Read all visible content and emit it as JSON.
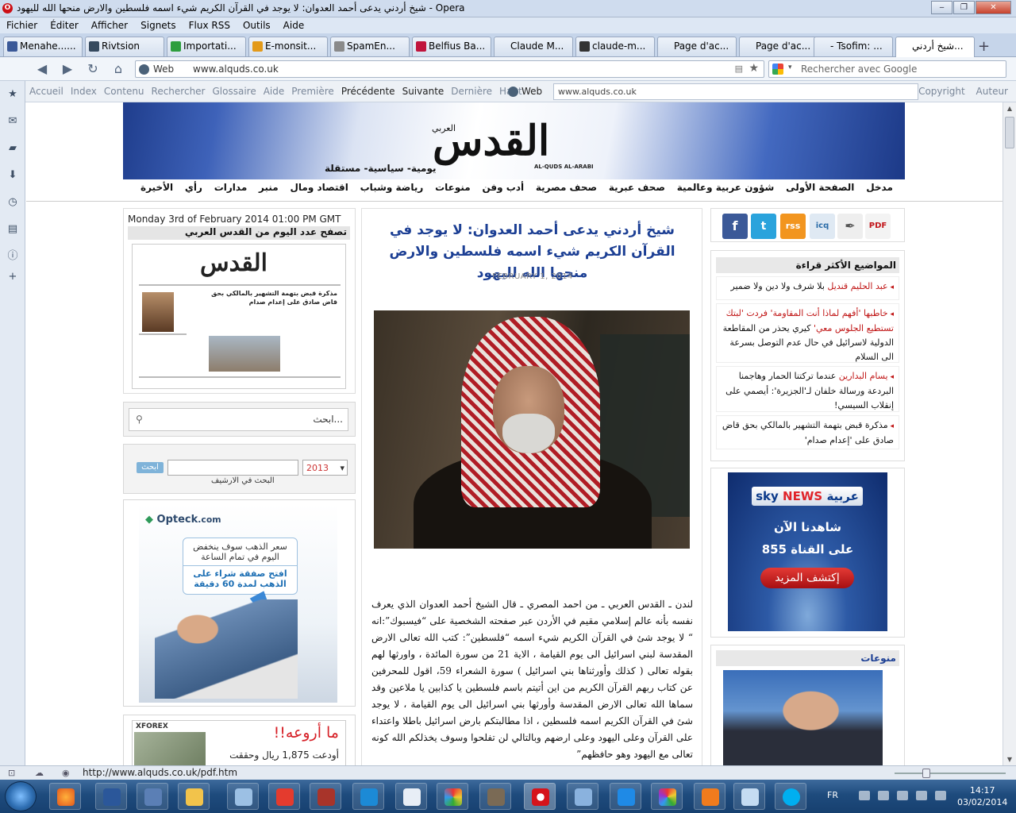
{
  "window": {
    "title": "شيخ أردني يدعى أحمد العدوان: لا يوجد في القرآن الكريم شيء اسمه فلسطين والارض منحها الله لليهود - Opera",
    "min": "‒",
    "max": "❐",
    "close": "✕"
  },
  "menu": [
    "Fichier",
    "Éditer",
    "Afficher",
    "Signets",
    "Flux RSS",
    "Outils",
    "Aide"
  ],
  "tabs": [
    {
      "label": "Menahe......",
      "color": "#3b5998"
    },
    {
      "label": "Rivtsion",
      "color": "#35495e"
    },
    {
      "label": "Importati...",
      "color": "#2e9e3e"
    },
    {
      "label": "E-monsit...",
      "color": "#e39a1a"
    },
    {
      "label": "SpamEn...",
      "color": "#8a8a8a"
    },
    {
      "label": "Belfius Ba...",
      "color": "#c0143c"
    },
    {
      "label": "Claude M...",
      "color": "#dddddd"
    },
    {
      "label": "claude-m...",
      "color": "#333333"
    },
    {
      "label": "Page d'ac...",
      "color": "#dddddd"
    },
    {
      "label": "Page d'ac...",
      "color": "#dddddd"
    },
    {
      "label": "- Tsofim: ...",
      "color": "#dddddd"
    },
    {
      "label": "شيخ أردني...",
      "color": "#ffffff"
    }
  ],
  "address": {
    "web": "Web",
    "url": "www.alquds.co.uk",
    "search_placeholder": "Rechercher avec Google"
  },
  "navbar": {
    "items": [
      "Accueil",
      "Index",
      "Contenu",
      "Rechercher",
      "Glossaire",
      "Aide",
      "Première",
      "Précédente",
      "Suivante",
      "Dernière",
      "Haut"
    ],
    "web": "Web",
    "url": "www.alquds.co.uk",
    "right": [
      "Copyright",
      "Auteur"
    ]
  },
  "site": {
    "logo": "القدس",
    "logo_sub": "العربي",
    "logo_en": "AL-QUDS AL-ARABI",
    "tagline": "يومية- سياسية- مستقلة",
    "nav": [
      "مدخل",
      "الصفحة الأولى",
      "شؤون عربية وعالمية",
      "صحف عبرية",
      "صحف مصرية",
      "أدب وفن",
      "منوعات",
      "رياضة وشباب",
      "اقتصاد ومال",
      "منبر",
      "مدارات",
      "رأي",
      "الأخيرة"
    ],
    "date": "Monday 3rd of February 2014 01:00 PM GMT",
    "paper_header": "تصفح عدد اليوم من القدس العربي",
    "paper_logo": "القدس",
    "paper_headline": "مذكرة قبض بتهمة التشهير بالمالكي بحق قاض صادق على إعدام صدام",
    "search_placeholder": "ابحث...",
    "archive": {
      "button": "ابحث",
      "year": "2013",
      "label": "البحث في الارشيف"
    },
    "ad1": {
      "brand": "Opteck",
      "brand_suffix": ".com",
      "line1": "سعر الذهب سوف ينخفض اليوم في تمام الساعة",
      "line2": "افتح صفقة شراء على الذهب لمدة 60 دقيقة"
    },
    "ad2": {
      "brand": "XFOREX",
      "headline": "ما أروعه!!",
      "sub": "أودعت 1,875 ريال وحققت"
    },
    "article": {
      "headline": "شيخ أردني يدعى أحمد العدوان: لا يوجد في القرآن الكريم شيء اسمه فلسطين والارض منحها الله لليهود",
      "date": "FEBRUARY 1, 2014",
      "body": "لندن ـ القدس العربي ـ من احمد المصري ـ قال الشيخ أحمد العدوان الذي يعرف نفسه بأنه عالم إسلامي مقيم في الأردن عبر صفحته الشخصية على “فيسبوك”:انه “ لا يوجد شئ في القرآن الكريم شيء اسمه “فلسطين”: كتب الله تعالى الارض المقدسة لبني اسرائيل الى يوم القيامة ، الاية 21 من سورة المائدة ، واورثها لهم بقوله تعالى ( كذلك وأورثناها بني اسرائيل ) سورة الشعراء 59، اقول للمحرفين عن كتاب ربهم القرآن الكريم من اين أتيتم باسم فلسطين يا كذابين يا ملاعين وقد سماها الله تعالى الارض المقدسة وأورثها بني اسرائيل الى يوم القيامة ، لا يوجد شئ في القرآن الكريم اسمه فلسطين ، اذا مطالبتكم بارض اسرائيل باطلا واعتداء على القرآن وعلى اليهود وعلى ارضهم وبالتالي لن تفلحوا وسوف يخذلكم الله كونه تعالى مع اليهود وهو حافظهم”"
    },
    "social": [
      "f",
      "t",
      "rss",
      "icq",
      "✒",
      "PDF"
    ],
    "popular_title": "المواضيع الأكثر قراءة",
    "popular": [
      {
        "bold": "عبد الحليم قنديل",
        "text": "بلا شرف ولا دين ولا ضمير"
      },
      {
        "bold": "خاطبها 'أفهم لماذا أنت المقاومة' فردت 'لبتك تستطيع الجلوس معي'",
        "text": "كيري يحذر من المقاطعة الدولية لاسرائيل في حال عدم التوصل بسرعة الى السلام"
      },
      {
        "bold": "يسام البدارين",
        "text": "عندما تركتنا الحمار وهاجمنا البردعة ورسالة خلفان لـ'الجزيرة': أيصمي على إنقلاب السيسي!"
      },
      {
        "bold": "",
        "text": "مذكرة قبض بتهمة التشهير بالمالكي بحق قاض صادق على 'إعدام صدام'"
      }
    ],
    "sky": {
      "brand1": "sky",
      "brand2": "NEWS",
      "brand3": "عربية",
      "line1": "شاهدنا الآن",
      "line2": "على القناة 855",
      "cta": "إكتشف المزيد"
    },
    "misc_title": "منوعات"
  },
  "status": {
    "url": "http://www.alquds.co.uk/pdf.htm"
  },
  "taskbar": {
    "lang": "FR",
    "time": "14:17",
    "date": "03/02/2014"
  }
}
